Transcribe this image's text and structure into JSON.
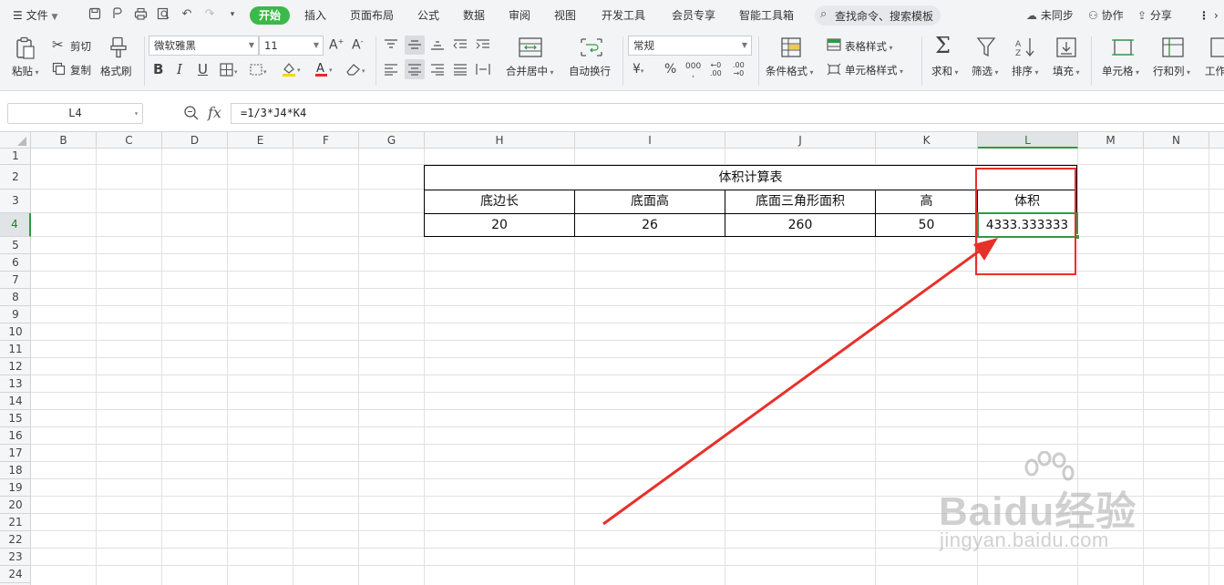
{
  "menubar": {
    "file": "文件",
    "tabs": [
      "开始",
      "插入",
      "页面布局",
      "公式",
      "数据",
      "审阅",
      "视图",
      "开发工具",
      "会员专享",
      "智能工具箱"
    ],
    "active_tab": "开始",
    "search_placeholder": "查找命令、搜索模板",
    "sync": "未同步",
    "collab": "协作",
    "share": "分享"
  },
  "ribbon": {
    "paste": "粘贴",
    "cut": "剪切",
    "copy": "复制",
    "format_painter": "格式刷",
    "font_name": "微软雅黑",
    "font_size": "11",
    "merge_center": "合并居中",
    "wrap_text": "自动换行",
    "number_format": "常规",
    "conditional_format": "条件格式",
    "table_style": "表格样式",
    "cell_style": "单元格样式",
    "sum": "求和",
    "filter": "筛选",
    "sort": "排序",
    "fill": "填充",
    "cell": "单元格",
    "row_col": "行和列",
    "worksheet": "工作"
  },
  "formula_bar": {
    "name_box": "L4",
    "fx": "fx",
    "formula": "=1/3*J4*K4"
  },
  "grid": {
    "columns": [
      "B",
      "C",
      "D",
      "E",
      "F",
      "G",
      "H",
      "I",
      "J",
      "K",
      "L",
      "M",
      "N"
    ],
    "rows": [
      "1",
      "2",
      "3",
      "4",
      "5",
      "6",
      "7",
      "8",
      "9",
      "10",
      "11",
      "12",
      "13",
      "14",
      "15",
      "16",
      "17",
      "18",
      "19",
      "20",
      "21",
      "22",
      "23",
      "24"
    ],
    "selected_col": "L",
    "selected_row": "4"
  },
  "table": {
    "title": "体积计算表",
    "headers": [
      "底边长",
      "底面高",
      "底面三角形面积",
      "高",
      "体积"
    ],
    "values": [
      "20",
      "26",
      "260",
      "50",
      "4333.333333"
    ]
  },
  "watermark": {
    "brand": "Baidu经验",
    "url": "jingyan.baidu.com"
  },
  "colors": {
    "accent_green": "#3bb94a",
    "selection_green": "#2f9a46",
    "annotation_red": "#e8302a"
  }
}
